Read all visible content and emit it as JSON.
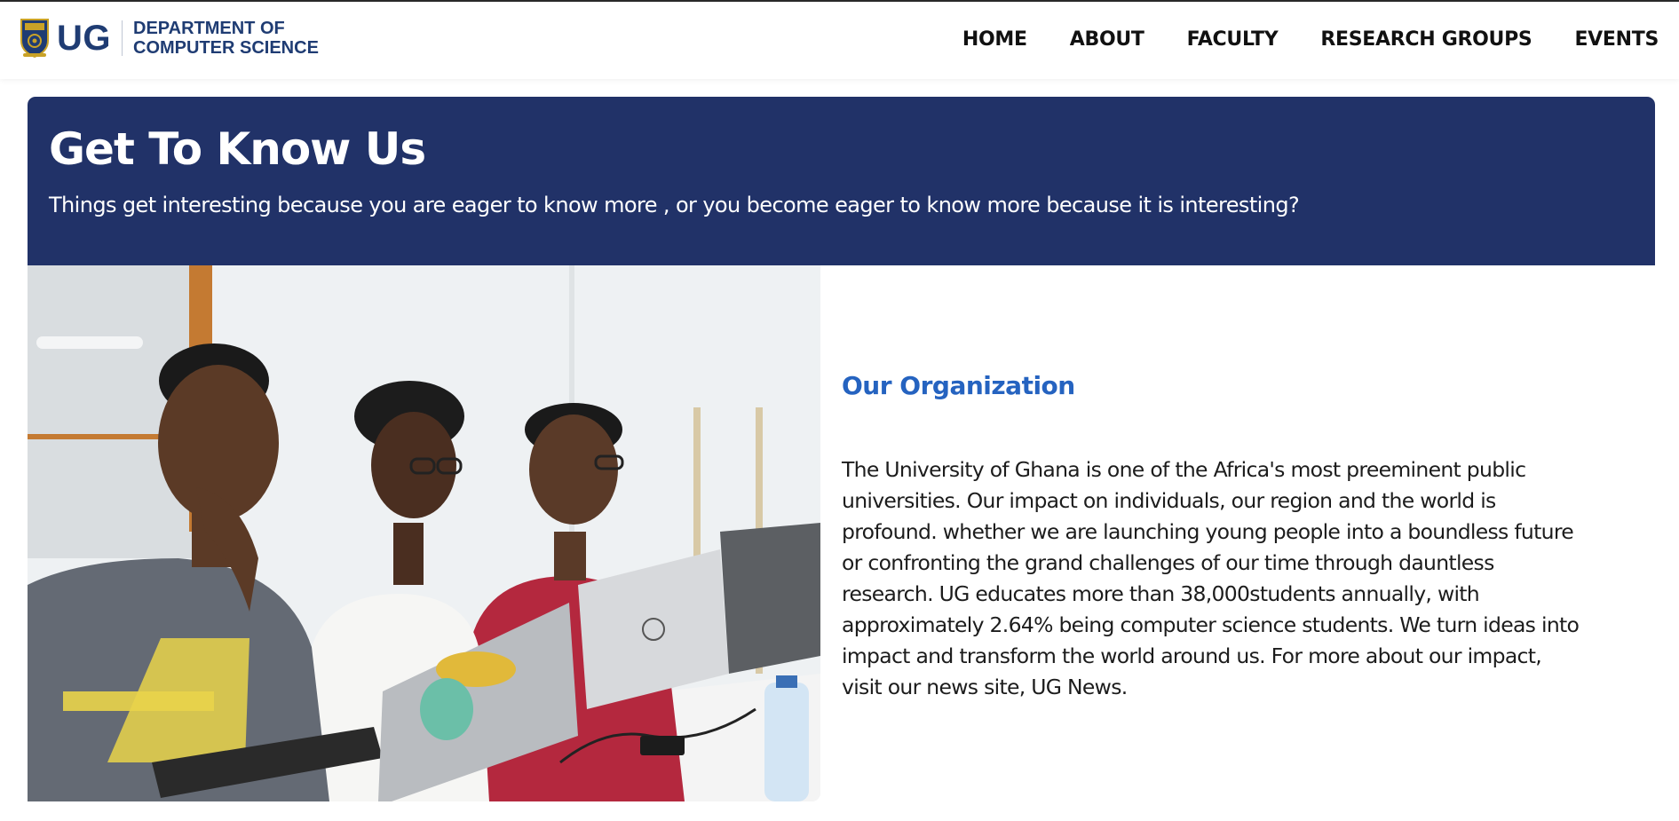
{
  "header": {
    "brand_short": "UG",
    "brand_dept_line1": "DEPARTMENT OF",
    "brand_dept_line2": "COMPUTER SCIENCE",
    "crest_icon": "university-crest-icon",
    "nav": [
      {
        "label": "HOME"
      },
      {
        "label": "ABOUT"
      },
      {
        "label": "FACULTY"
      },
      {
        "label": "RESEARCH GROUPS"
      },
      {
        "label": "EVENTS"
      }
    ]
  },
  "banner": {
    "title": "Get To Know Us",
    "subtitle": "Things get interesting because you are eager to know more , or you become eager to know more because it is interesting?"
  },
  "photo": {
    "icon": "students-at-laptops-photo"
  },
  "organization": {
    "heading": "Our Organization",
    "body_lines": [
      "The University of Ghana is one of the Africa's most preeminent public",
      "universities. Our impact on individuals, our region and the world is",
      "profound. whether we are launching young people into a boundless future",
      "or confronting the grand challenges of our time through dauntless",
      "research. UG educates more than 38,000students annually, with",
      "approximately 2.64% being computer science students. We turn ideas into",
      "impact and transform the world around us. For more about our impact,",
      "visit our news site, UG News."
    ]
  },
  "colors": {
    "brand_navy": "#1f3c73",
    "banner_bg": "#213268",
    "heading_blue": "#2563c0",
    "text": "#1c1c1c"
  }
}
